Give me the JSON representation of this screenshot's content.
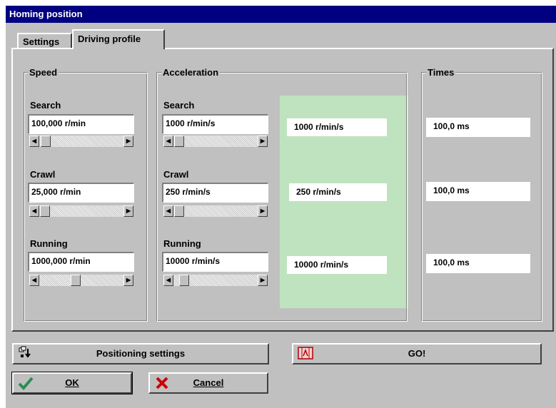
{
  "window": {
    "title": "Homing position"
  },
  "tabs": [
    {
      "label": "Settings"
    },
    {
      "label": "Driving profile"
    }
  ],
  "speed": {
    "legend": "Speed",
    "search": {
      "label": "Search",
      "value": "100,000 r/min",
      "thumb_fraction": 0.1
    },
    "crawl": {
      "label": "Crawl",
      "value": "25,000 r/min",
      "thumb_fraction": 0.02
    },
    "running": {
      "label": "Running",
      "value": "1000,000 r/min",
      "thumb_fraction": 0.35
    }
  },
  "acceleration": {
    "legend": "Acceleration",
    "search": {
      "label": "Search",
      "value": "1000 r/min/s",
      "display": "1000  r/min/s",
      "thumb_fraction": 0.02
    },
    "crawl": {
      "label": "Crawl",
      "value": "250 r/min/s",
      "display": "250  r/min/s",
      "thumb_fraction": 0.01
    },
    "running": {
      "label": "Running",
      "value": "10000 r/min/s",
      "display": "10000  r/min/s",
      "thumb_fraction": 0.1
    }
  },
  "times": {
    "legend": "Times",
    "search": "100,0 ms",
    "crawl": "100,0 ms",
    "running": "100,0 ms"
  },
  "buttons": {
    "positioning_settings": "Positioning settings",
    "go": "GO!",
    "ok": "OK",
    "cancel": "Cancel"
  },
  "icons": {
    "positioning_settings": "positioning-settings-icon",
    "go": "film-icon",
    "ok": "checkmark-icon",
    "cancel": "red-x-icon"
  },
  "colors": {
    "title_bar": "#000080",
    "highlight_green": "#bfe3bf",
    "cancel_x": "#cc0000",
    "ok_check": "#2e8b57"
  }
}
